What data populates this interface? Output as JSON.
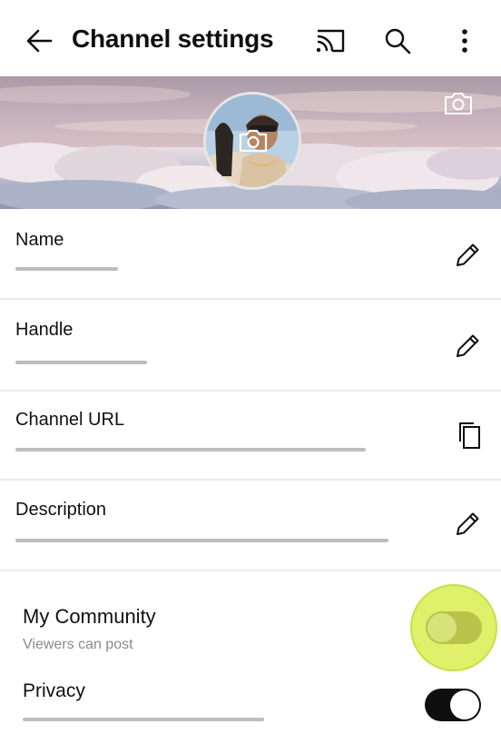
{
  "header": {
    "title": "Channel settings",
    "icons": [
      "back-arrow-icon",
      "cast-icon",
      "search-icon",
      "more-vert-icon"
    ]
  },
  "banner": {
    "icons": [
      "banner-camera-icon",
      "avatar-camera-icon"
    ]
  },
  "fields": [
    {
      "label": "Name",
      "action_icon": "pencil-icon"
    },
    {
      "label": "Handle",
      "action_icon": "pencil-icon"
    },
    {
      "label": "Channel URL",
      "action_icon": "copy-icon"
    },
    {
      "label": "Description",
      "action_icon": "pencil-icon"
    }
  ],
  "community": {
    "title": "My Community",
    "subtitle": "Viewers can post",
    "toggle_on": false
  },
  "privacy": {
    "title": "Privacy",
    "toggle_on": true
  },
  "colors": {
    "highlight": "#dff06a",
    "toggle_on_track": "#0f0f0f",
    "placeholder_bar": "#bdbdbd"
  }
}
